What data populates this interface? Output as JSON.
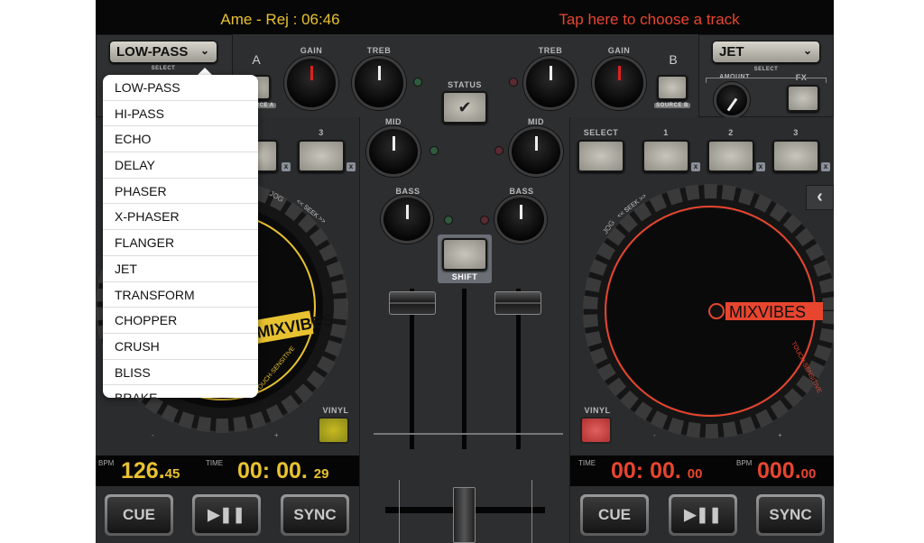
{
  "header": {
    "left_track": "Ame - Rej : 06:46",
    "right_track": "Tap here to choose a track"
  },
  "colors": {
    "deck_a": "#e8c230",
    "deck_b": "#e8452f",
    "popup_bg": "#ffffff"
  },
  "deck_a": {
    "fx_select": "LOW-PASS",
    "fx_select_label": "SELECT",
    "fx_slot_3": "3",
    "jog_label": "JOG",
    "seek_label": "<< SEEK >>",
    "logo": "MIXVIBES",
    "touch_label": "TOUCH-SENSITIVE",
    "vinyl_label": "VINYL",
    "bpm_label": "BPM",
    "bpm_main": "126.",
    "bpm_dec": "45",
    "time_label": "TIME",
    "time_main": "00: 00.",
    "time_frac": "29",
    "cue": "CUE",
    "play": "▶❚❚",
    "sync": "SYNC",
    "pitch_minus": "-",
    "pitch_plus": "+"
  },
  "deck_b": {
    "fx_select": "JET",
    "select_label": "SELECT",
    "amount_label": "AMOUNT",
    "fx_label": "FX",
    "fx_select_btn": "SELECT",
    "fx_slots": [
      "1",
      "2",
      "3"
    ],
    "jog_label": "JOG",
    "seek_label": "<< SEEK >>",
    "logo": "MIXVIBES",
    "touch_label": "TOUCH-SENSITIVE",
    "vinyl_label": "VINYL",
    "time_label": "TIME",
    "time_main": "00: 00.",
    "time_frac": "00",
    "bpm_label": "BPM",
    "bpm_main": "000.",
    "bpm_dec": "00",
    "cue": "CUE",
    "play": "▶❚❚",
    "sync": "SYNC",
    "pitch_minus": "-",
    "pitch_plus": "+",
    "side_arrow": "‹"
  },
  "mixer": {
    "gain": "GAIN",
    "treb": "TREB",
    "mid": "MID",
    "bass": "BASS",
    "status": "STATUS",
    "status_icon": "✔",
    "shift": "SHIFT",
    "source_a": "SOURCE A",
    "source_b": "SOURCE B",
    "headphone_a": "A",
    "headphone_b": "B"
  },
  "fx_menu": {
    "items": [
      "LOW-PASS",
      "HI-PASS",
      "ECHO",
      "DELAY",
      "PHASER",
      "X-PHASER",
      "FLANGER",
      "JET",
      "TRANSFORM",
      "CHOPPER",
      "CRUSH",
      "BLISS",
      "BRAKE"
    ]
  }
}
